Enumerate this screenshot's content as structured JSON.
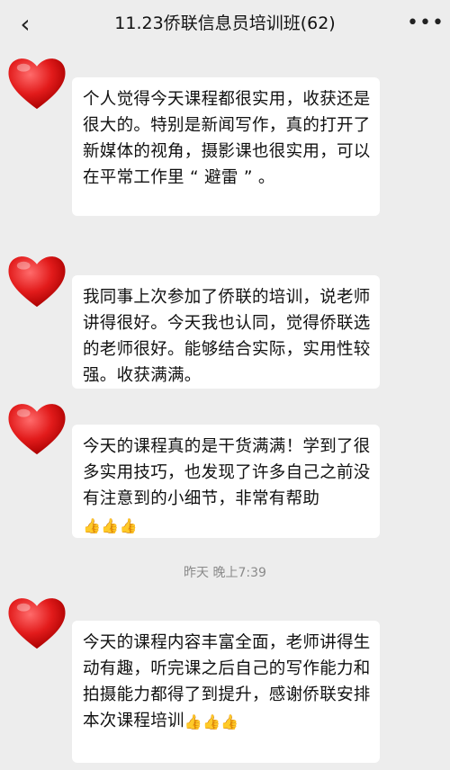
{
  "header": {
    "back_icon": "chevron-left-icon",
    "title": "11.23侨联信息员培训班(62)",
    "more_icon": "more-dots-icon"
  },
  "messages": [
    {
      "avatar_icon": "heart-icon",
      "text": "个人觉得今天课程都很实用，收获还是很大的。特别是新闻写作，真的打开了新媒体的视角，摄影课也很实用，可以在平常工作里 “ 避雷 ” 。"
    },
    {
      "avatar_icon": "heart-icon",
      "text": "我同事上次参加了侨联的培训，说老师讲得很好。今天我也认同，觉得侨联选的老师很好。能够结合实际，实用性较强。收获满满。"
    },
    {
      "avatar_icon": "heart-icon",
      "text": "今天的课程真的是干货满满！学到了很多实用技巧，也发现了许多自己之前没有注意到的小细节，非常有帮助",
      "emoji": "👍👍👍"
    },
    {
      "avatar_icon": "heart-icon",
      "text": "今天的课程内容丰富全面，老师讲得生动有趣，听完课之后自己的写作能力和拍摄能力都得了到提升，感谢侨联安排本次课程培训",
      "emoji": "👍👍👍"
    }
  ],
  "timestamp": "昨天 晚上7:39"
}
